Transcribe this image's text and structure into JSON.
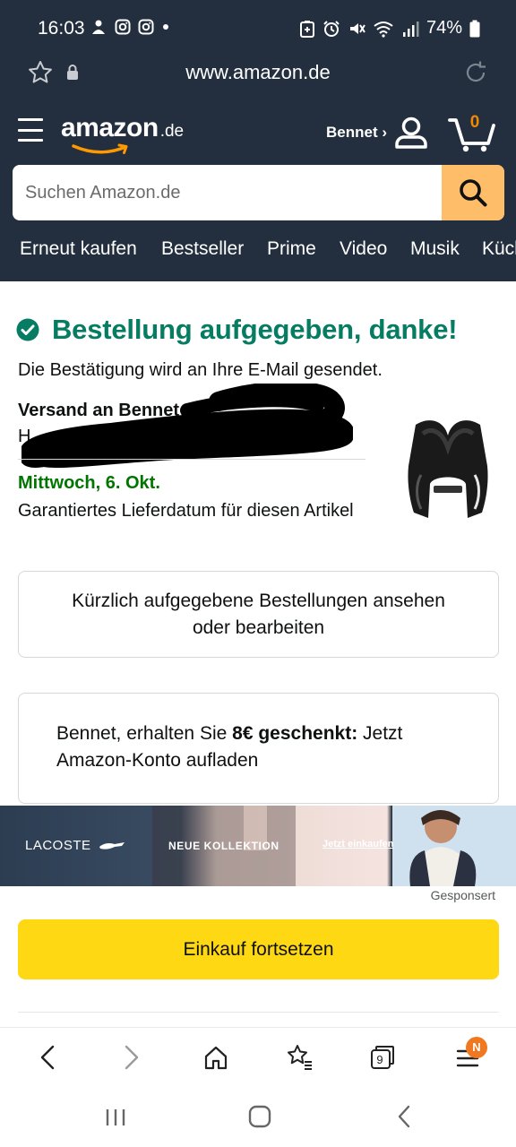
{
  "status_bar": {
    "time": "16:03",
    "battery": "74%",
    "left_icons": [
      "notification-icon",
      "instagram-icon",
      "instagram-icon",
      "dot-icon"
    ],
    "right_icons": [
      "nfc-icon",
      "alarm-icon",
      "mute-icon",
      "wifi-icon",
      "signal-icon",
      "battery-icon"
    ]
  },
  "browser": {
    "url": "www.amazon.de",
    "tabs_count": "9",
    "menu_badge": "N"
  },
  "header": {
    "logo": "amazon",
    "logo_tld": ".de",
    "account_label": "Bennet ›",
    "cart_count": "0",
    "search_placeholder": "Suchen Amazon.de"
  },
  "categories": [
    "Erneut kaufen",
    "Bestseller",
    "Prime",
    "Video",
    "Musik",
    "Küch"
  ],
  "order": {
    "title": "Bestellung aufgegeben, danke!",
    "subtitle": "Die Bestätigung wird an Ihre E-Mail gesendet.",
    "shipping_to": "Versand an Bennet Co",
    "address_initial": "H",
    "delivery_date": "Mittwoch, 6. Okt.",
    "delivery_note": "Garantiertes Lieferdatum für diesen Artikel"
  },
  "actions": {
    "view_orders": "Kürzlich aufgegebene Bestellungen ansehen oder bearbeiten",
    "continue_shopping": "Einkauf fortsetzen"
  },
  "promo": {
    "prefix": "Bennet, erhalten Sie ",
    "bold": "8€ geschenkt:",
    "suffix": " Jetzt Amazon-Konto aufladen"
  },
  "ad": {
    "brand": "LACOSTE",
    "headline": "NEUE KOLLEKTION",
    "cta": "Jetzt einkaufen",
    "sponsored": "Gesponsert"
  },
  "colors": {
    "header_bg": "#232f3e",
    "success_green": "#067d62",
    "delivery_green": "#007600",
    "search_button": "#febd69",
    "primary_button": "#ffd814",
    "cart_count": "#f08804"
  }
}
